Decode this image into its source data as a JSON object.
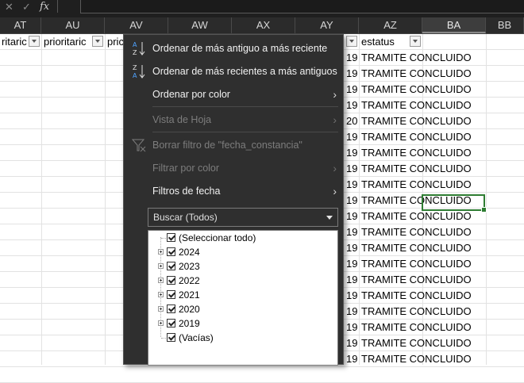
{
  "formula_bar": {
    "fx_label": "fx",
    "value": ""
  },
  "columns": [
    {
      "id": "AT",
      "label": "AT"
    },
    {
      "id": "AU",
      "label": "AU"
    },
    {
      "id": "AV",
      "label": "AV"
    },
    {
      "id": "AW",
      "label": "AW"
    },
    {
      "id": "AX",
      "label": "AX"
    },
    {
      "id": "AY",
      "label": "AY"
    },
    {
      "id": "AZ",
      "label": "AZ"
    },
    {
      "id": "BA",
      "label": "BA",
      "selected": true
    },
    {
      "id": "BB",
      "label": "BB"
    }
  ],
  "header_row": {
    "at": "ritaric",
    "au": "prioritaric",
    "av": "pric",
    "az": "estatus"
  },
  "ay_partial_values": [
    "19",
    "19",
    "19",
    "19",
    "20",
    "19",
    "19",
    "19",
    "19",
    "19",
    "19",
    "19",
    "19",
    "19",
    "19",
    "19",
    "19",
    "19",
    "19",
    "19"
  ],
  "status_values": [
    "TRAMITE CONCLUIDO",
    "TRAMITE CONCLUIDO",
    "TRAMITE CONCLUIDO",
    "TRAMITE CONCLUIDO",
    "TRAMITE CONCLUIDO",
    "TRAMITE CONCLUIDO",
    "TRAMITE CONCLUIDO",
    "TRAMITE CONCLUIDO",
    "TRAMITE CONCLUIDO",
    "TRAMITE CONCLUIDO",
    "TRAMITE CONCLUIDO",
    "TRAMITE CONCLUIDO",
    "TRAMITE CONCLUIDO",
    "TRAMITE CONCLUIDO",
    "TRAMITE CONCLUIDO",
    "TRAMITE CONCLUIDO",
    "TRAMITE CONCLUIDO",
    "TRAMITE CONCLUIDO",
    "TRAMITE CONCLUIDO",
    "TRAMITE CONCLUIDO"
  ],
  "menu": {
    "sort_asc": "Ordenar de más antiguo a más reciente",
    "sort_desc": "Ordenar de más recientes a más antiguos",
    "sort_color": "Ordenar por color",
    "sheet_view": "Vista de Hoja",
    "clear_filter": "Borrar filtro de \"fecha_constancia\"",
    "filter_color": "Filtrar por color",
    "date_filters": "Filtros de fecha",
    "search_placeholder": "Buscar (Todos)",
    "tree": [
      {
        "label": "(Seleccionar todo)",
        "checked": true,
        "expandable": false
      },
      {
        "label": "2024",
        "checked": true,
        "expandable": true
      },
      {
        "label": "2023",
        "checked": true,
        "expandable": true
      },
      {
        "label": "2022",
        "checked": true,
        "expandable": true
      },
      {
        "label": "2021",
        "checked": true,
        "expandable": true
      },
      {
        "label": "2020",
        "checked": true,
        "expandable": true
      },
      {
        "label": "2019",
        "checked": true,
        "expandable": true
      },
      {
        "label": "(Vacías)",
        "checked": true,
        "expandable": false
      }
    ]
  },
  "icons": {
    "cancel": "close-icon",
    "enter": "check-icon",
    "sort_asc": "sort-ascending-icon",
    "sort_desc": "sort-descending-icon",
    "clear_filter": "clear-filter-icon"
  },
  "colors": {
    "accent": "#2e7d32",
    "menu_bg": "#2f2f2f",
    "header_bg": "#2b2b2b"
  }
}
